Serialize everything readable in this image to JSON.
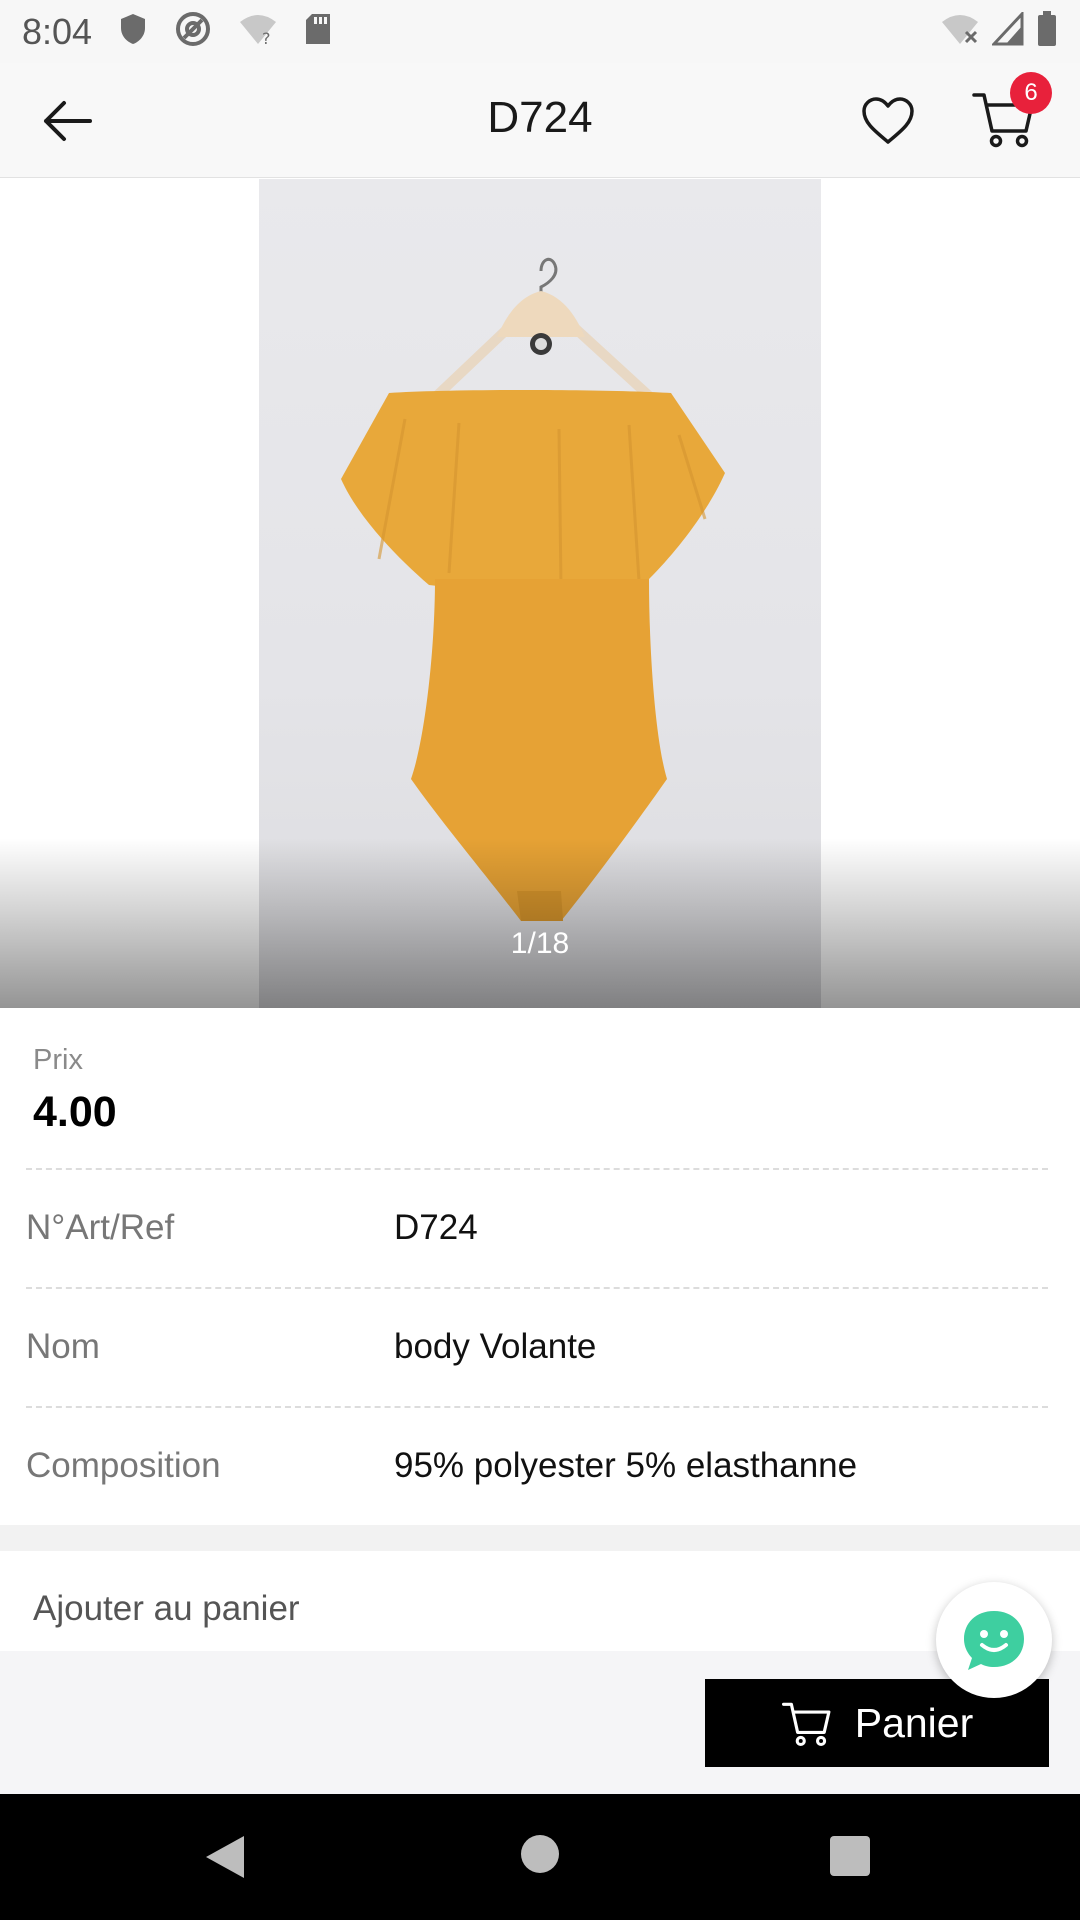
{
  "status_bar": {
    "time": "8:04",
    "icons": [
      "shield-icon",
      "at-sync-icon",
      "wifi-question-icon",
      "sd-card-icon"
    ],
    "right_icons": [
      "wifi-off-icon",
      "signal-icon",
      "battery-icon"
    ]
  },
  "app_bar": {
    "title": "D724",
    "cart_count": "6"
  },
  "gallery": {
    "counter": "1/18"
  },
  "price": {
    "label": "Prix",
    "value": "4.00"
  },
  "details": [
    {
      "label": "N°Art/Ref",
      "value": "D724"
    },
    {
      "label": "Nom",
      "value": "body Volante"
    },
    {
      "label": "Composition",
      "value": "95% polyester 5% elasthanne"
    }
  ],
  "add_to_cart": {
    "label": "Ajouter au panier"
  },
  "bottom": {
    "panier_label": "Panier"
  },
  "colors": {
    "accent_badge": "#e8213b",
    "chat_green": "#3ecfa0",
    "garment": "#e8a83a"
  }
}
